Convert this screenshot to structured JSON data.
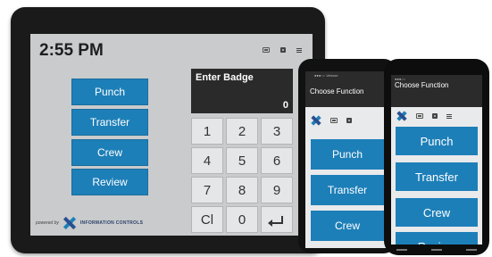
{
  "tablet": {
    "clock": "2:55 PM",
    "badge_label": "Enter Badge",
    "badge_value": "0",
    "buttons": [
      "Punch",
      "Transfer",
      "Crew",
      "Review"
    ],
    "keys": [
      "1",
      "2",
      "3",
      "4",
      "5",
      "6",
      "7",
      "8",
      "9",
      "Cl",
      "0",
      "enter"
    ],
    "powered_by": "powered by",
    "brand": "INFORMATION CONTROLS",
    "colors": {
      "button": "#1d7fb8",
      "screen": "#c9cbcc",
      "badge_bg": "#2a2a2a"
    }
  },
  "phone_back": {
    "status": "●●●○○ Verizon",
    "title": "Choose Function",
    "buttons": [
      "Punch",
      "Transfer",
      "Crew"
    ]
  },
  "phone_front": {
    "status": "●●●○○",
    "title": "Choose Function",
    "buttons": [
      "Punch",
      "Transfer",
      "Crew",
      "Review"
    ]
  },
  "icons": [
    "battery-icon",
    "camera-icon",
    "menu-icon",
    "enter-icon",
    "ic-logo-icon"
  ]
}
